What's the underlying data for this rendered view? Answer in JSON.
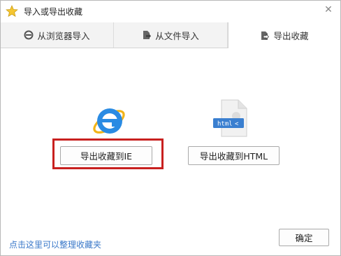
{
  "window": {
    "title": "导入或导出收藏",
    "icon": "star-icon",
    "close_symbol": "✕"
  },
  "tabs": [
    {
      "label": "从浏览器导入",
      "icon": "browser-e-icon",
      "active": false
    },
    {
      "label": "从文件导入",
      "icon": "file-import-icon",
      "active": false
    },
    {
      "label": "导出收藏",
      "icon": "export-file-icon",
      "active": true
    }
  ],
  "export": {
    "ie_button_label": "导出收藏到IE",
    "html_button_label": "导出收藏到HTML",
    "html_icon_text": "html",
    "highlight_color": "#c8201f"
  },
  "footer": {
    "link_text": "点击这里可以整理收藏夹",
    "ok_button_label": "确定"
  }
}
